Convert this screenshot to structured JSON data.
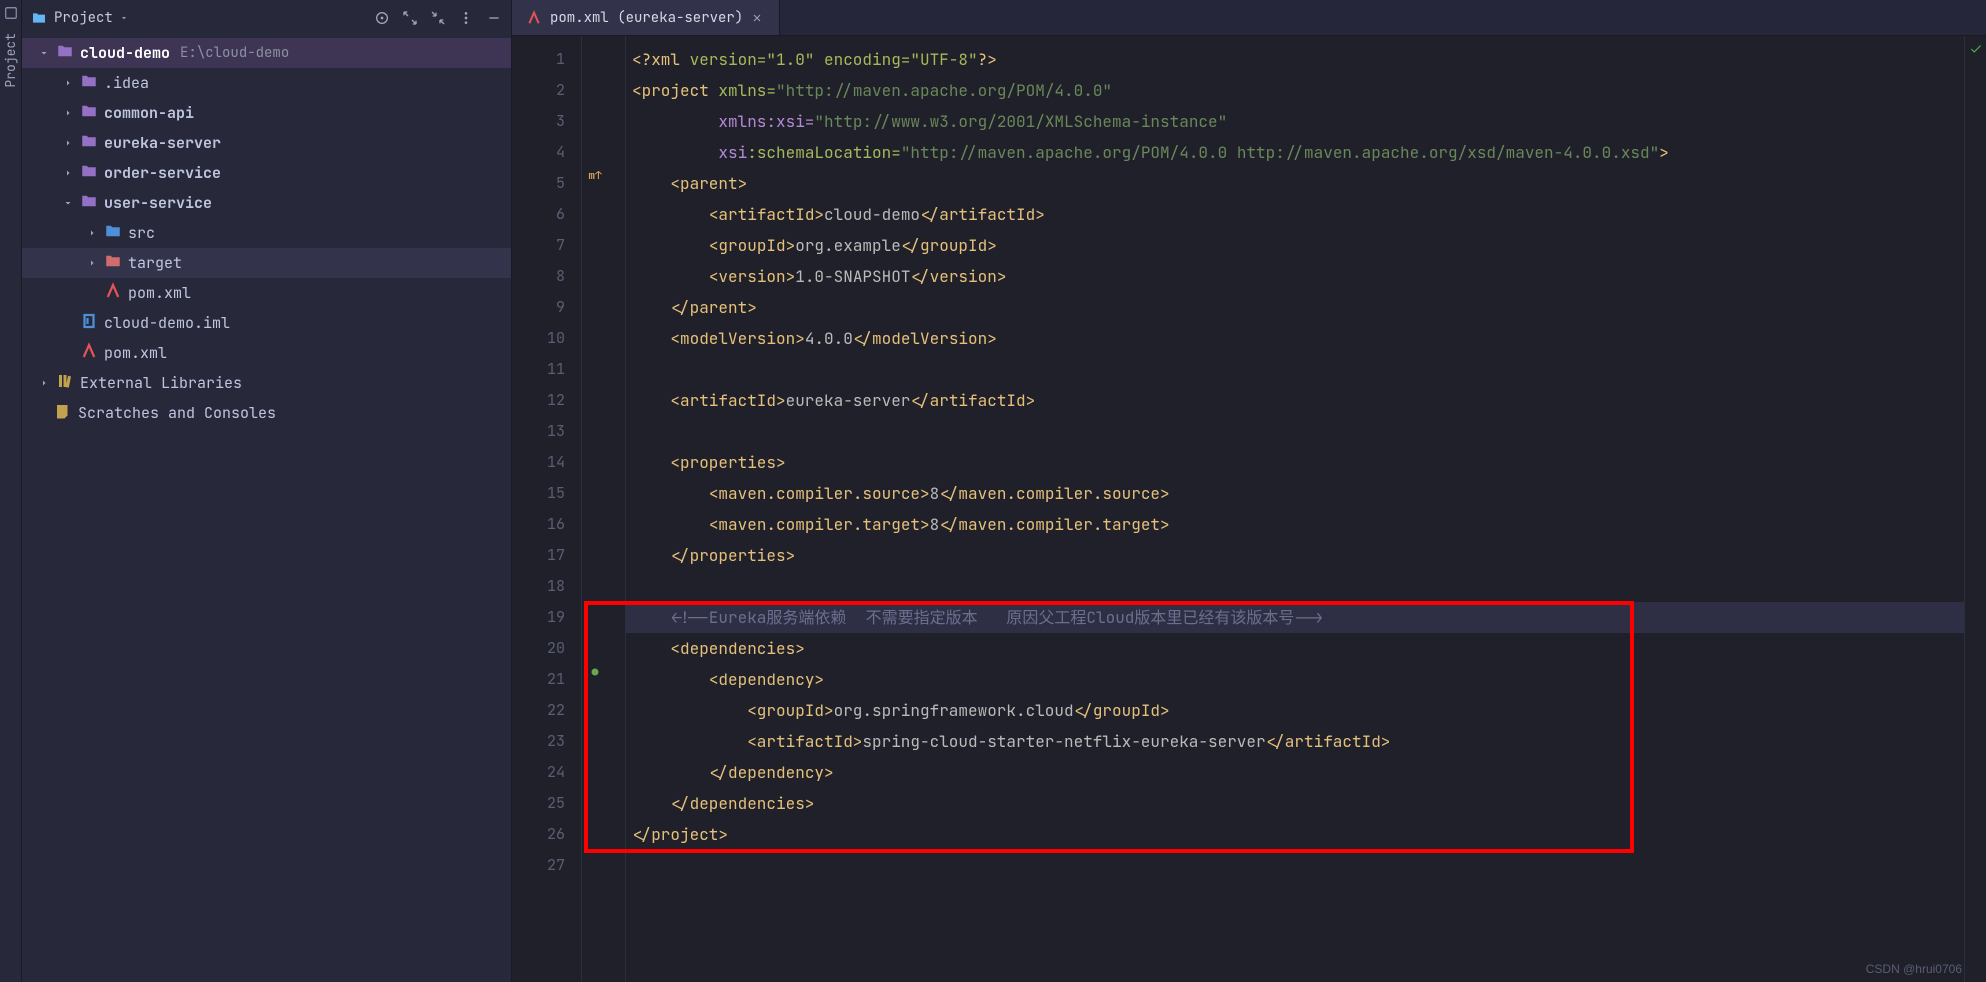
{
  "rail": {
    "label": "Project"
  },
  "panel": {
    "title": "Project",
    "project_name": "cloud-demo",
    "project_path": "E:\\cloud-demo",
    "nodes": {
      "idea": ".idea",
      "common_api": "common-api",
      "eureka_server": "eureka-server",
      "order_service": "order-service",
      "user_service": "user-service",
      "src": "src",
      "target": "target",
      "pom_user": "pom.xml",
      "iml": "cloud-demo.iml",
      "pom_root": "pom.xml",
      "ext_lib": "External Libraries",
      "scratches": "Scratches and Consoles"
    }
  },
  "tab": {
    "label": "pom.xml (eureka-server)"
  },
  "code": {
    "lines": [
      "1",
      "2",
      "3",
      "4",
      "5",
      "6",
      "7",
      "8",
      "9",
      "10",
      "11",
      "12",
      "13",
      "14",
      "15",
      "16",
      "17",
      "18",
      "19",
      "20",
      "21",
      "22",
      "23",
      "24",
      "25",
      "26",
      "27"
    ]
  },
  "xml": {
    "decl_a": "<?xml ",
    "decl_b": "version=\"1.0\" encoding=\"UTF-8\"",
    "decl_c": "?>",
    "proj_open": "<project ",
    "proj_ns": "xmlns=",
    "proj_ns_v": "\"http://maven.apache.org/POM/4.0.0\"",
    "proj_xsi": "xmlns:xsi=",
    "proj_xsi_v": "\"http://www.w3.org/2001/XMLSchema-instance\"",
    "proj_sl_k": "xsi",
    "proj_sl_k2": ":schemaLocation=",
    "proj_sl_v": "\"http://maven.apache.org/POM/4.0.0 http://maven.apache.org/xsd/maven-4.0.0.xsd\"",
    "close": ">",
    "parent_o": "<parent>",
    "artifact_o": "<artifactId>",
    "artifact_c": "</artifactId>",
    "artifact_v": "cloud-demo",
    "group_o": "<groupId>",
    "group_c": "</groupId>",
    "group_v": "org.example",
    "version_o": "<version>",
    "version_c": "</version>",
    "version_v": "1.0-SNAPSHOT",
    "parent_c": "</parent>",
    "modelv_o": "<modelVersion>",
    "modelv_c": "</modelVersion>",
    "modelv_v": "4.0.0",
    "artifact_self": "eureka-server",
    "props_o": "<properties>",
    "mcs_o": "<maven.compiler.source>",
    "mcs_c": "</maven.compiler.source>",
    "mcs_v": "8",
    "mct_o": "<maven.compiler.target>",
    "mct_c": "</maven.compiler.target>",
    "mct_v": "8",
    "props_c": "</properties>",
    "comment": "<!--Eureka服务端依赖  不需要指定版本   原因父工程Cloud版本里已经有该版本号-->",
    "deps_o": "<dependencies>",
    "dep_o": "<dependency>",
    "dep_group": "org.springframework.cloud",
    "dep_artifact": "spring-cloud-starter-netflix-eureka-server",
    "dep_c": "</dependency>",
    "deps_c": "</dependencies>",
    "proj_c": "</project>"
  },
  "watermark": "CSDN @hrui0706"
}
